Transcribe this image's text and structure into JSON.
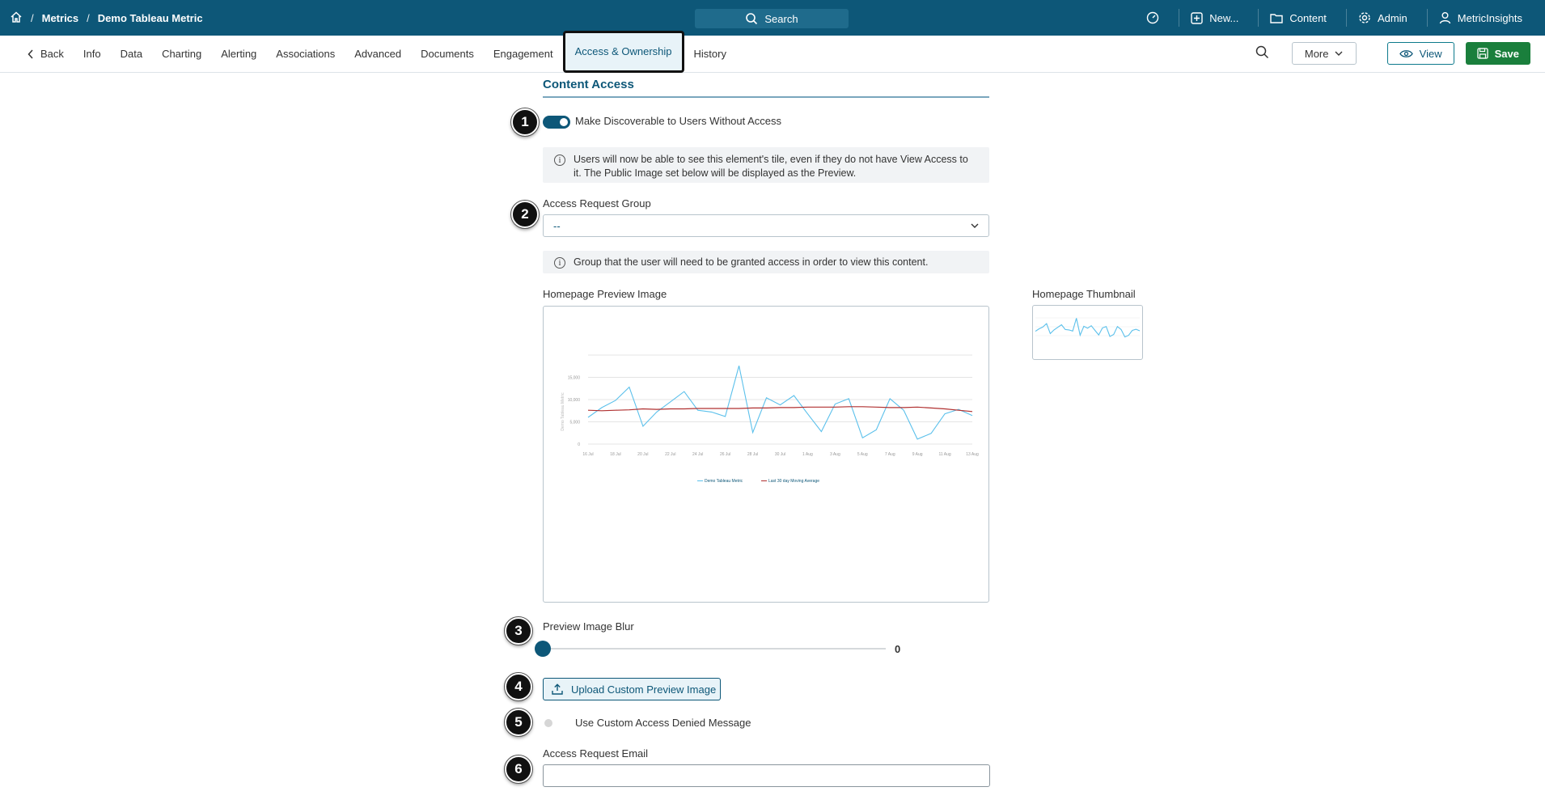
{
  "topbar": {
    "breadcrumbs": [
      "Metrics",
      "Demo Tableau Metric"
    ],
    "search_label": "Search",
    "right_items": [
      "New...",
      "Content",
      "Admin",
      "MetricInsights"
    ]
  },
  "tabs": {
    "back": "Back",
    "items": [
      "Info",
      "Data",
      "Charting",
      "Alerting",
      "Associations",
      "Advanced",
      "Documents",
      "Engagement",
      "Access & Ownership",
      "History"
    ],
    "active": "Access & Ownership",
    "more_label": "More",
    "view_label": "View",
    "save_label": "Save"
  },
  "content": {
    "section_title": "Content Access",
    "discoverable_label": "Make Discoverable to Users Without Access",
    "discoverable_on": true,
    "discoverable_info": "Users will now be able to see this element's tile, even if they do not have View Access to it. The Public Image set below will be displayed as the Preview.",
    "access_group_label": "Access Request Group",
    "access_group_value": "--",
    "access_group_info": "Group that the user will need to be granted access in order to view this content.",
    "preview_label": "Homepage Preview Image",
    "thumbnail_label": "Homepage Thumbnail",
    "blur_label": "Preview Image Blur",
    "blur_value": "0",
    "upload_label": "Upload Custom Preview Image",
    "custom_denied_label": "Use Custom Access Denied Message",
    "custom_denied_on": false,
    "request_email_label": "Access Request Email",
    "request_email_value": ""
  },
  "markers": [
    "1",
    "2",
    "3",
    "4",
    "5",
    "6"
  ],
  "colors": {
    "brand": "#0d5778",
    "save": "#1a7f3c",
    "series_metric": "#5bc0eb",
    "series_avg": "#b03030"
  },
  "chart_data": {
    "type": "line",
    "ylabel": "Demo Tableau Metric",
    "y_ticks": [
      "15,000",
      "10,000",
      "5,000",
      "0"
    ],
    "ylim": [
      0,
      20000
    ],
    "x_ticks": [
      "16 Jul",
      "18 Jul",
      "20 Jul",
      "22 Jul",
      "24 Jul",
      "26 Jul",
      "28 Jul",
      "30 Jul",
      "1 Aug",
      "3 Aug",
      "5 Aug",
      "7 Aug",
      "9 Aug",
      "11 Aug",
      "13 Aug"
    ],
    "series": [
      {
        "name": "Demo Tableau Metric",
        "values": [
          6000,
          8200,
          9800,
          12800,
          4000,
          7200,
          9500,
          11800,
          7600,
          7200,
          6200,
          17600,
          2600,
          10400,
          8800,
          10900,
          6800,
          2800,
          9000,
          10200,
          1400,
          3200,
          10200,
          7600,
          1100,
          2400,
          6800,
          7800,
          6400
        ]
      },
      {
        "name": "Last 30 day Moving Average",
        "values": [
          7600,
          7500,
          7600,
          7700,
          7900,
          7800,
          7900,
          7900,
          8000,
          8000,
          8000,
          8000,
          8100,
          8100,
          8200,
          8200,
          8300,
          8300,
          8300,
          8400,
          8400,
          8300,
          8200,
          8200,
          8300,
          8100,
          7900,
          7600,
          7300
        ]
      }
    ],
    "legend": "bottom"
  }
}
